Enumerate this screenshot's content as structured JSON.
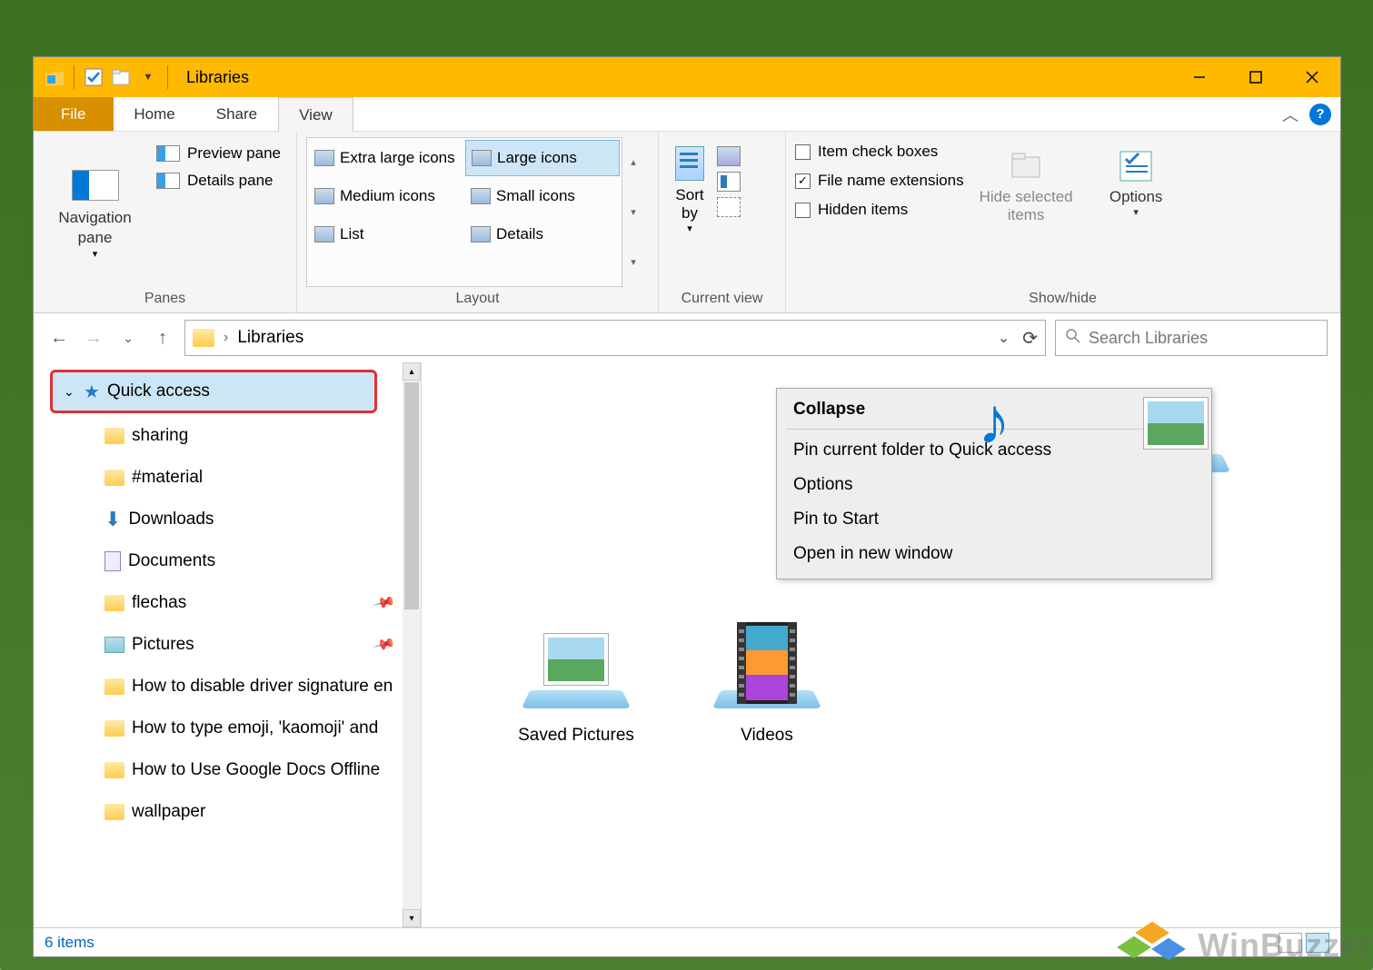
{
  "titlebar": {
    "title": "Libraries"
  },
  "tabs": {
    "file": "File",
    "home": "Home",
    "share": "Share",
    "view": "View"
  },
  "ribbon": {
    "panes": {
      "label": "Panes",
      "navigation_pane": "Navigation\npane",
      "preview_pane": "Preview pane",
      "details_pane": "Details pane"
    },
    "layout": {
      "label": "Layout",
      "items": [
        "Extra large icons",
        "Large icons",
        "Medium icons",
        "Small icons",
        "List",
        "Details"
      ],
      "selected_index": 1
    },
    "current_view": {
      "label": "Current view",
      "sort_by": "Sort\nby"
    },
    "showhide": {
      "label": "Show/hide",
      "item_check_boxes": "Item check boxes",
      "file_name_extensions": "File name extensions",
      "hidden_items": "Hidden items",
      "hide_selected": "Hide selected\nitems",
      "options": "Options"
    }
  },
  "address": {
    "path": "Libraries",
    "refresh_glyph": "⟳",
    "search_placeholder": "Search Libraries"
  },
  "sidebar": {
    "quick_access": "Quick access",
    "items": [
      {
        "label": "sharing",
        "icon": "folder",
        "pinned": false
      },
      {
        "label": "#material",
        "icon": "folder",
        "pinned": false
      },
      {
        "label": "Downloads",
        "icon": "download",
        "pinned": false
      },
      {
        "label": "Documents",
        "icon": "doc",
        "pinned": false
      },
      {
        "label": "flechas",
        "icon": "folder",
        "pinned": true
      },
      {
        "label": "Pictures",
        "icon": "pic",
        "pinned": true
      },
      {
        "label": "How to disable driver signature en",
        "icon": "folder",
        "pinned": false
      },
      {
        "label": "How to type emoji, 'kaomoji' and",
        "icon": "folder",
        "pinned": false
      },
      {
        "label": "How to Use Google Docs Offline",
        "icon": "folder",
        "pinned": false
      },
      {
        "label": "wallpaper",
        "icon": "folder",
        "pinned": false
      }
    ]
  },
  "libraries": [
    {
      "label": "Music",
      "kind": "music"
    },
    {
      "label": "Pictures",
      "kind": "pictures"
    },
    {
      "label": "Saved Pictures",
      "kind": "pictures"
    },
    {
      "label": "Videos",
      "kind": "videos"
    }
  ],
  "context_menu": {
    "header": "Collapse",
    "items": [
      "Pin current folder to Quick access",
      "Options",
      "Pin to Start",
      "Open in new window"
    ]
  },
  "statusbar": {
    "count": "6 items"
  },
  "watermark": {
    "text": "WinBuzzer"
  }
}
